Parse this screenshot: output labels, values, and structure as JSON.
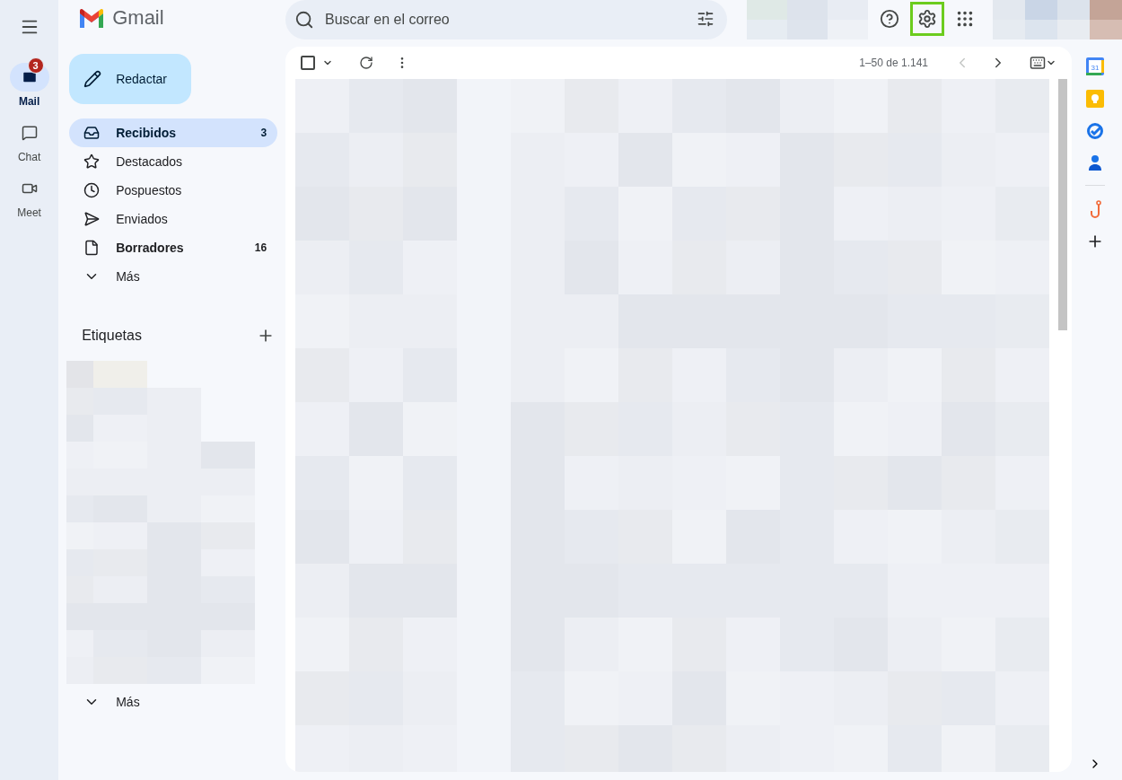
{
  "app": {
    "name": "Gmail"
  },
  "rail": [
    {
      "kind": "mail",
      "label": "Mail",
      "selected": true,
      "badge": "3"
    },
    {
      "kind": "chat",
      "label": "Chat",
      "selected": false
    },
    {
      "kind": "meet",
      "label": "Meet",
      "selected": false
    }
  ],
  "compose": {
    "label": "Redactar"
  },
  "folders": [
    {
      "kind": "inbox",
      "label": "Recibidos",
      "count": "3",
      "selected": true,
      "bold": true
    },
    {
      "kind": "star",
      "label": "Destacados",
      "selected": false,
      "bold": false
    },
    {
      "kind": "clock",
      "label": "Pospuestos",
      "selected": false,
      "bold": false
    },
    {
      "kind": "send",
      "label": "Enviados",
      "selected": false,
      "bold": false
    },
    {
      "kind": "file",
      "label": "Borradores",
      "count": "16",
      "selected": false,
      "bold": true
    },
    {
      "kind": "more",
      "label": "Más",
      "selected": false,
      "bold": false
    }
  ],
  "labels": {
    "title": "Etiquetas",
    "more": "Más"
  },
  "search": {
    "placeholder": "Buscar en el correo"
  },
  "header_icons": [
    {
      "kind": "help",
      "highlighted": false
    },
    {
      "kind": "settings",
      "highlighted": true
    },
    {
      "kind": "apps",
      "highlighted": false
    }
  ],
  "toolbar": {
    "select_all_checked": false,
    "range": "1–50 de 1.141",
    "prev_disabled": true,
    "next_disabled": false
  },
  "side_apps": [
    {
      "kind": "calendar",
      "label": "31"
    },
    {
      "kind": "keep"
    },
    {
      "kind": "tasks"
    },
    {
      "kind": "contacts"
    },
    {
      "kind": "divider"
    },
    {
      "kind": "hook"
    },
    {
      "kind": "add"
    }
  ]
}
